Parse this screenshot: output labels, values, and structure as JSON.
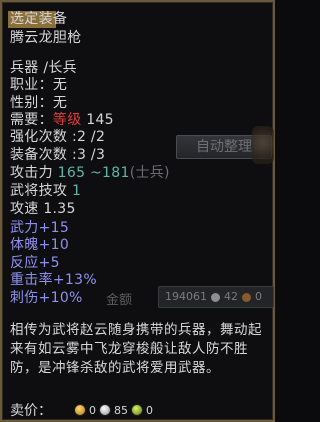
{
  "title": "选定装备",
  "item_name": "腾云龙胆枪",
  "stats": {
    "weapon_type": "兵器 /长兵",
    "class": "职业：无",
    "gender": "性别：无",
    "level_label": "需要：",
    "level_red": "等级",
    "level_value": " 145",
    "enhance": "强化次数 :2 /2",
    "equip_times": "装备次数 :3 /3",
    "attack_label": "攻击力 ",
    "attack_range": "165 ~181",
    "attack_type": "(士兵)",
    "skill_label": "武将技攻 ",
    "skill_value": "1",
    "speed": "攻速 1.35",
    "bonus_power": "武力+15",
    "bonus_stamina": "体魄+10",
    "bonus_reflex": "反应+5",
    "bonus_crit": "重击率+13%",
    "bonus_pierce": "刺伤+10%"
  },
  "description": "相传为武将赵云随身携带的兵器，舞动起来有如云雾中飞龙穿梭般让敌人防不胜防，是冲锋杀敌的武将爱用武器。",
  "price": {
    "label": "卖价：",
    "gold": "0",
    "silver": "85",
    "copper": "0"
  },
  "background": {
    "auto_sort_label": "自动整理",
    "gold_label": "金额",
    "gold_value": "194061",
    "silver_value": "42",
    "copper_value": "0"
  }
}
